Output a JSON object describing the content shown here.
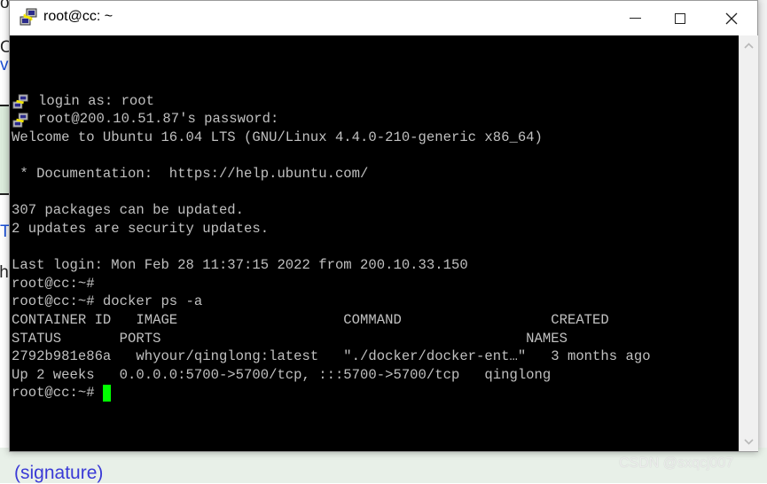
{
  "window": {
    "title": "root@cc: ~",
    "buttons": {
      "minimize": "minimize",
      "maximize": "maximize",
      "close": "close"
    }
  },
  "terminal": {
    "lines": [
      {
        "icon": "putty-icon",
        "text": "login as: root"
      },
      {
        "icon": "putty-icon",
        "text": "root@200.10.51.87's password:"
      },
      {
        "text": "Welcome to Ubuntu 16.04 LTS (GNU/Linux 4.4.0-210-generic x86_64)"
      },
      {
        "text": ""
      },
      {
        "text": " * Documentation:  https://help.ubuntu.com/"
      },
      {
        "text": ""
      },
      {
        "text": "307 packages can be updated."
      },
      {
        "text": "2 updates are security updates."
      },
      {
        "text": ""
      },
      {
        "text": "Last login: Mon Feb 28 11:37:15 2022 from 200.10.33.150"
      },
      {
        "text": "root@cc:~#"
      },
      {
        "text": "root@cc:~# docker ps -a"
      },
      {
        "text": "CONTAINER ID   IMAGE                    COMMAND                  CREATED"
      },
      {
        "text": "STATUS       PORTS                                            NAMES"
      },
      {
        "text": "2792b981e86a   whyour/qinglong:latest   \"./docker/docker-ent…\"   3 months ago"
      },
      {
        "text": "Up 2 weeks   0.0.0.0:5700->5700/tcp, :::5700->5700/tcp   qinglong"
      }
    ],
    "prompt": "root@cc:~# ",
    "cursor_color": "#00ff00"
  },
  "background": {
    "signature_link": "(signature)",
    "fragments": [
      "o",
      "O",
      "v",
      "T",
      "th"
    ]
  },
  "watermark": "CSDN @sxqcj007"
}
